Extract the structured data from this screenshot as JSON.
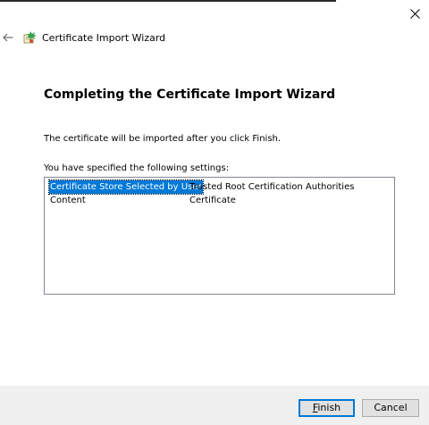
{
  "wizard": {
    "title": "Certificate Import Wizard",
    "heading": "Completing the Certificate Import Wizard",
    "description": "The certificate will be imported after you click Finish.",
    "settings_label": "You have specified the following settings:",
    "settings": [
      {
        "key": "Certificate Store Selected by User",
        "value": "Trusted Root Certification Authorities",
        "selected": true
      },
      {
        "key": "Content",
        "value": "Certificate",
        "selected": false
      }
    ]
  },
  "buttons": {
    "finish_accel": "F",
    "finish_rest": "inish",
    "cancel": "Cancel"
  },
  "icons": {
    "close": "close-icon",
    "back": "back-arrow-icon",
    "wizard": "certificate-wizard-icon"
  },
  "colors": {
    "selection": "#0078d7",
    "footer": "#f0f0f0",
    "list_border": "#828790"
  }
}
